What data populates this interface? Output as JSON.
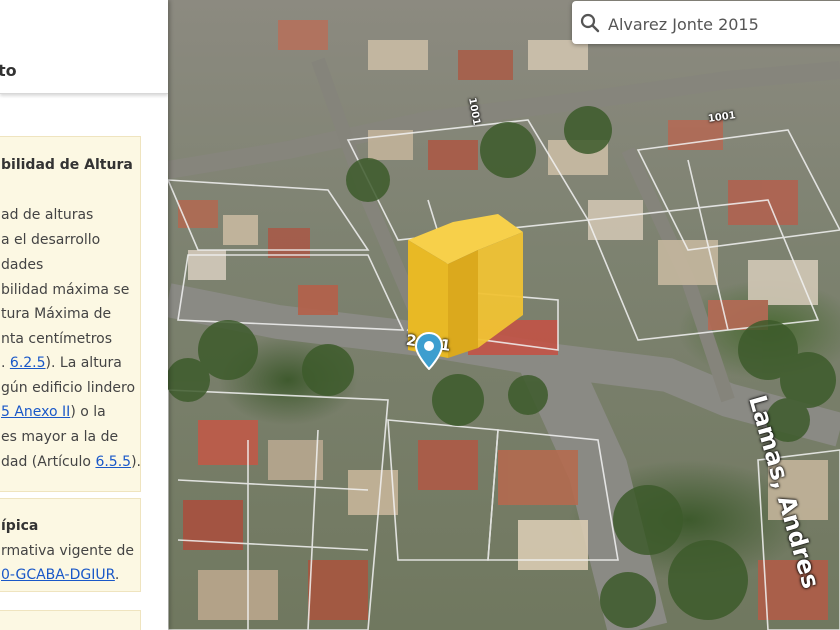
{
  "search": {
    "value": "Alvarez Jonte 2015"
  },
  "panel": {
    "title": "to",
    "card1": {
      "title": "bilidad de Altura",
      "l1": "ad de alturas",
      "l2": "a el desarrollo",
      "l3": "dades",
      "l4": "bilidad máxima se",
      "l5": "tura Máxima de",
      "l6": "nta centímetros",
      "l7_pre": ". ",
      "l7_link": "6.2.5",
      "l7_post": "). La altura",
      "l8": "gún edificio lindero",
      "l9_link": "5 Anexo II",
      "l9_post": ") o la",
      "l10": "es mayor a la de",
      "l11_pre": "dad (Artículo ",
      "l11_link": "6.5.5",
      "l11_post": ")."
    },
    "card2": {
      "title": "ípica",
      "l1": "rmativa vigente de",
      "l2_link": "0-GCABA-DGIUR",
      "l2_post": "."
    }
  },
  "map": {
    "streets": {
      "address_number": "2001",
      "avenue": "Lamas, Andres",
      "block_a": "1001",
      "block_b": "1001"
    },
    "building_color": "#f2c12e",
    "pin_color": "#3d9ecf"
  },
  "icons": {
    "search": "search-icon",
    "pin": "location-pin-icon"
  }
}
